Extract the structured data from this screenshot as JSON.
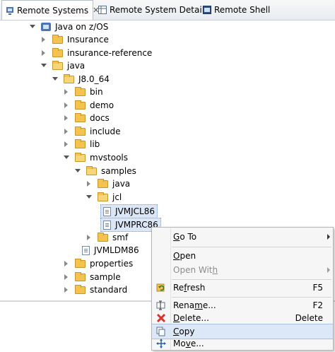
{
  "tabs": [
    {
      "label": "Remote Systems",
      "close": "✕",
      "active": true,
      "icon": "remote-systems-icon"
    },
    {
      "label": "Remote System Details",
      "active": false,
      "icon": "details-table-icon"
    },
    {
      "label": "Remote Shell",
      "active": false,
      "icon": "shell-icon"
    }
  ],
  "tree": [
    {
      "label": "Java on z/OS",
      "kind": "system",
      "toggle": "open"
    },
    {
      "label": "Insurance",
      "kind": "folder",
      "toggle": "closed"
    },
    {
      "label": "insurance-reference",
      "kind": "folder",
      "toggle": "closed"
    },
    {
      "label": "java",
      "kind": "folder-open",
      "toggle": "open"
    },
    {
      "label": "J8.0_64",
      "kind": "folder-open",
      "toggle": "open"
    },
    {
      "label": "bin",
      "kind": "folder",
      "toggle": "closed"
    },
    {
      "label": "demo",
      "kind": "folder",
      "toggle": "closed"
    },
    {
      "label": "docs",
      "kind": "folder",
      "toggle": "closed"
    },
    {
      "label": "include",
      "kind": "folder",
      "toggle": "closed"
    },
    {
      "label": "lib",
      "kind": "folder",
      "toggle": "closed"
    },
    {
      "label": "mvstools",
      "kind": "folder-open",
      "toggle": "open"
    },
    {
      "label": "samples",
      "kind": "folder-open",
      "toggle": "open"
    },
    {
      "label": "java",
      "kind": "folder",
      "toggle": "closed"
    },
    {
      "label": "jcl",
      "kind": "folder-open",
      "toggle": "open"
    },
    {
      "label": "JVMJCL86",
      "kind": "file",
      "toggle": "none",
      "selected": true
    },
    {
      "label": "JVMPRC86",
      "kind": "file",
      "toggle": "none",
      "selected": true
    },
    {
      "label": "smf",
      "kind": "folder",
      "toggle": "closed"
    },
    {
      "label": "JVMLDM86",
      "kind": "file",
      "toggle": "none"
    },
    {
      "label": "properties",
      "kind": "folder",
      "toggle": "closed"
    },
    {
      "label": "sample",
      "kind": "folder",
      "toggle": "closed"
    },
    {
      "label": "standard",
      "kind": "folder",
      "toggle": "closed"
    }
  ],
  "context_menu": {
    "goto": {
      "label": "Go To",
      "underline": "G",
      "rest": "o To",
      "icon": ""
    },
    "open": {
      "label": "Open",
      "underline": "O",
      "rest": "pen"
    },
    "open_with": {
      "label": "Open With",
      "pre": "Open Wit",
      "underline": "h",
      "disabled": true
    },
    "refresh": {
      "label": "Refresh",
      "pre": "Re",
      "underline": "f",
      "rest": "resh",
      "shortcut": "F5",
      "icon": "refresh-icon"
    },
    "rename": {
      "label": "Rename...",
      "pre": "Rena",
      "underline": "m",
      "rest": "e...",
      "shortcut": "F2",
      "icon": "rename-icon"
    },
    "delete": {
      "label": "Delete...",
      "underline": "D",
      "rest": "elete...",
      "shortcut": "Delete",
      "icon": "delete-icon",
      "icon_color": "#d9342b"
    },
    "copy": {
      "label": "Copy",
      "underline": "C",
      "rest": "opy",
      "icon": "copy-icon",
      "highlighted": true
    },
    "move": {
      "label": "Move...",
      "pre": "Mo",
      "underline": "v",
      "rest": "e...",
      "icon": "move-icon"
    }
  },
  "colors": {
    "selection": "#dbe7f7",
    "menu_hover": "#dce8f8",
    "folder": "#f3c24f"
  }
}
